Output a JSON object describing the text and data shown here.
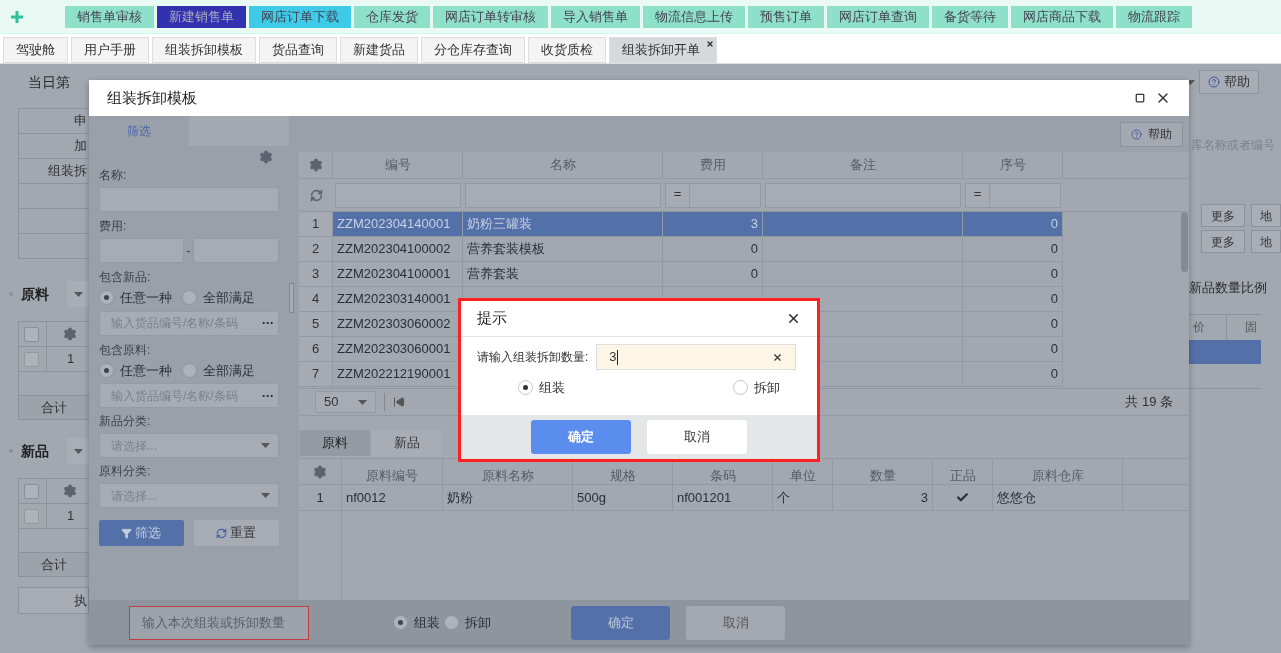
{
  "top_nav": [
    {
      "label": "销售单审核",
      "selected": false,
      "highlighted": false
    },
    {
      "label": "新建销售单",
      "selected": true,
      "highlighted": false
    },
    {
      "label": "网店订单下载",
      "selected": false,
      "highlighted": true
    },
    {
      "label": "仓库发货",
      "selected": false,
      "highlighted": false
    },
    {
      "label": "网店订单转审核",
      "selected": false,
      "highlighted": false
    },
    {
      "label": "导入销售单",
      "selected": false,
      "highlighted": false
    },
    {
      "label": "物流信息上传",
      "selected": false,
      "highlighted": false
    },
    {
      "label": "预售订单",
      "selected": false,
      "highlighted": false
    },
    {
      "label": "网店订单查询",
      "selected": false,
      "highlighted": false
    },
    {
      "label": "备货等待",
      "selected": false,
      "highlighted": false
    },
    {
      "label": "网店商品下载",
      "selected": false,
      "highlighted": false
    },
    {
      "label": "物流跟踪",
      "selected": false,
      "highlighted": false
    }
  ],
  "tabs": [
    {
      "label": "驾驶舱",
      "selected": false
    },
    {
      "label": "用户手册",
      "selected": false
    },
    {
      "label": "组装拆卸模板",
      "selected": false
    },
    {
      "label": "货品查询",
      "selected": false
    },
    {
      "label": "新建货品",
      "selected": false
    },
    {
      "label": "分仓库存查询",
      "selected": false
    },
    {
      "label": "收货质检",
      "selected": false
    },
    {
      "label": "组装拆卸开单",
      "selected": true
    }
  ],
  "background": {
    "day_label": "当日第",
    "help": "帮助",
    "left_cells": [
      "申",
      "加",
      "组装拆"
    ],
    "sections": [
      {
        "title": "原料",
        "all_checked": false,
        "row_checked": false,
        "row_no": "1",
        "total": "合计"
      },
      {
        "title": "新品",
        "all_checked": false,
        "row_checked": false,
        "row_no": "1",
        "total": "合计"
      }
    ],
    "bottom_button": "执",
    "search_placeholder": "库名称或者编号",
    "more_buttons": [
      "更多",
      "更多"
    ],
    "address_buttons": [
      "地",
      "地"
    ],
    "ratio_label": "新品数量比例",
    "right_headers": [
      "价",
      "固"
    ]
  },
  "template_dialog": {
    "title": "组装拆卸模板",
    "filter_tab": "筛选",
    "help": "帮助",
    "filters": {
      "name_label": "名称:",
      "fee_label": "费用:",
      "fee_sep": "-",
      "groups": [
        {
          "label": "包含新品:",
          "options": [
            {
              "label": "任意一种",
              "selected": true
            },
            {
              "label": "全部满足",
              "selected": false
            }
          ],
          "placeholder": "输入货品编号/名称/条码",
          "more": "···"
        },
        {
          "label": "包含原料:",
          "options": [
            {
              "label": "任意一种",
              "selected": true
            },
            {
              "label": "全部满足",
              "selected": false
            }
          ],
          "placeholder": "输入货品编号/名称/条码",
          "more": "···"
        }
      ],
      "selects": [
        {
          "label": "新品分类:",
          "placeholder": "请选择..."
        },
        {
          "label": "原料分类:",
          "placeholder": "请选择..."
        }
      ],
      "filter_button": "筛选",
      "reset_button": "重置"
    },
    "table": {
      "columns": [
        "编号",
        "名称",
        "费用",
        "备注",
        "序号"
      ],
      "fee_op": "=",
      "seq_op": "=",
      "rows": [
        {
          "no": "1",
          "code": "ZZM202304140001",
          "name": "奶粉三罐装",
          "fee": "3",
          "seq": "0",
          "selected": true
        },
        {
          "no": "2",
          "code": "ZZM202304100002",
          "name": "营养套装模板",
          "fee": "0",
          "seq": "0",
          "selected": false
        },
        {
          "no": "3",
          "code": "ZZM202304100001",
          "name": "营养套装",
          "fee": "0",
          "seq": "0",
          "selected": false
        },
        {
          "no": "4",
          "code": "ZZM202303140001",
          "seq": "0",
          "selected": false
        },
        {
          "no": "5",
          "code": "ZZM202303060002",
          "seq": "0",
          "selected": false
        },
        {
          "no": "6",
          "code": "ZZM202303060001",
          "seq": "0",
          "selected": false
        },
        {
          "no": "7",
          "code": "ZZM202212190001",
          "seq": "0",
          "selected": false
        }
      ],
      "page_size": "50",
      "total": "共 19 条"
    },
    "detail_tabs": [
      {
        "label": "原料",
        "selected": true
      },
      {
        "label": "新品",
        "selected": false
      }
    ],
    "detail_table": {
      "columns": [
        "原料编号",
        "原料名称",
        "规格",
        "条码",
        "单位",
        "数量",
        "正品",
        "原料仓库"
      ],
      "rows": [
        {
          "no": "1",
          "code": "nf0012",
          "name": "奶粉",
          "spec": "500g",
          "barcode": "nf001201",
          "unit": "个",
          "qty": "3",
          "genuine": true,
          "warehouse": "悠悠仓"
        }
      ]
    },
    "footer": {
      "qty_placeholder": "输入本次组装或拆卸数量",
      "modes": [
        {
          "label": "组装",
          "selected": true
        },
        {
          "label": "拆卸",
          "selected": false
        }
      ],
      "confirm": "确定",
      "cancel": "取消"
    }
  },
  "prompt_dialog": {
    "title": "提示",
    "field_label": "请输入组装拆卸数量:",
    "value": "3",
    "modes": [
      {
        "label": "组装",
        "selected": true
      },
      {
        "label": "拆卸",
        "selected": false
      }
    ],
    "confirm": "确定",
    "cancel": "取消"
  }
}
